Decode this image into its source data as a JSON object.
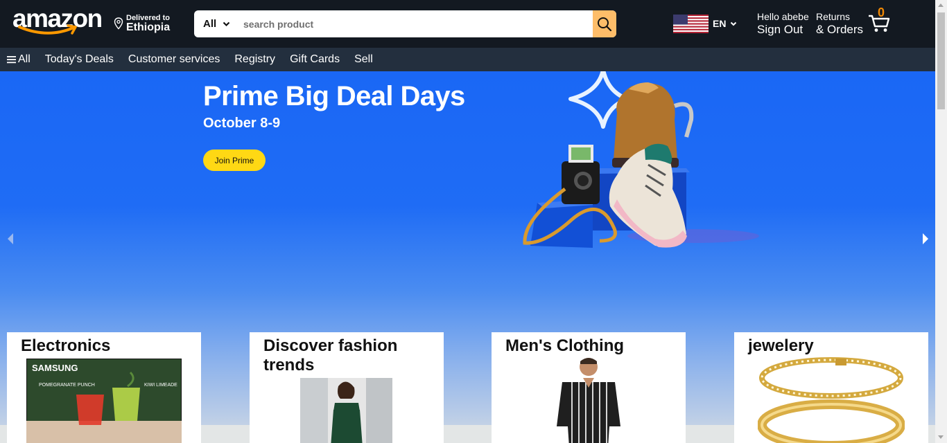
{
  "header": {
    "logo_text": "amazon",
    "deliver_label": "Delivered to",
    "deliver_location": "Ethiopia",
    "search": {
      "category": "All",
      "placeholder": "search product"
    },
    "language": "EN",
    "account_greeting": "Hello abebe",
    "account_action": "Sign Out",
    "returns_line1": "Returns",
    "returns_line2": "& Orders",
    "cart_count": "0"
  },
  "nav": {
    "all_label": "All",
    "items": [
      "Today's Deals",
      "Customer services",
      "Registry",
      "Gift Cards",
      "Sell"
    ]
  },
  "hero": {
    "title": "Prime Big Deal Days",
    "date": "October 8-9",
    "button": "Join Prime"
  },
  "cards": [
    {
      "title": "Electronics",
      "image_text": "SAMSUNG",
      "image_caption_1": "POMEGRANATE PUNCH",
      "image_caption_2": "KIWI LIMEADE"
    },
    {
      "title": "Discover fashion trends"
    },
    {
      "title": "Men's Clothing"
    },
    {
      "title": "jewelery"
    }
  ],
  "colors": {
    "header_bg": "#131921",
    "nav_bg": "#232f3e",
    "search_button": "#febd69",
    "cart_count": "#f08804",
    "hero_blue": "#1a67f5",
    "prime_button": "#ffd814"
  }
}
